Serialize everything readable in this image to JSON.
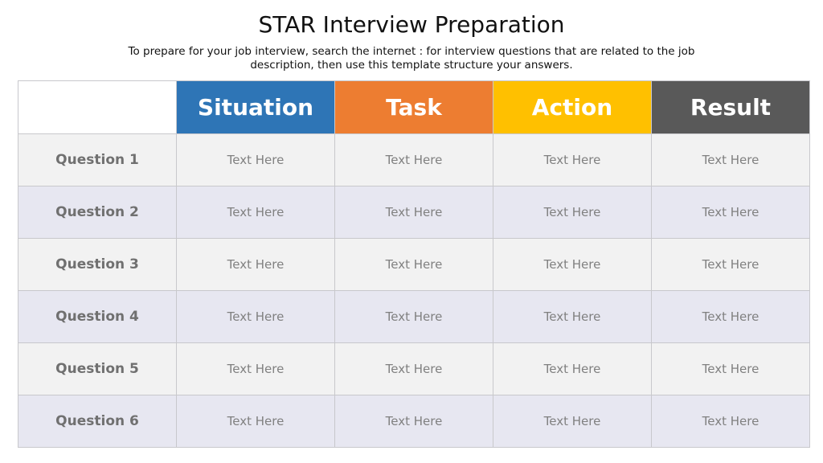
{
  "title": "STAR Interview Preparation",
  "subtitle": "To prepare for your job interview, search the internet : for interview questions that are related to the job description, then use this template structure your answers.",
  "columns": [
    {
      "label": "Situation",
      "color": "#2e75b6"
    },
    {
      "label": "Task",
      "color": "#ed7d31"
    },
    {
      "label": "Action",
      "color": "#ffc000"
    },
    {
      "label": "Result",
      "color": "#595959"
    }
  ],
  "rows": [
    {
      "label": "Question 1",
      "cells": [
        "Text Here",
        "Text Here",
        "Text Here",
        "Text Here"
      ]
    },
    {
      "label": "Question 2",
      "cells": [
        "Text Here",
        "Text Here",
        "Text Here",
        "Text Here"
      ]
    },
    {
      "label": "Question 3",
      "cells": [
        "Text Here",
        "Text Here",
        "Text Here",
        "Text Here"
      ]
    },
    {
      "label": "Question 4",
      "cells": [
        "Text Here",
        "Text Here",
        "Text Here",
        "Text Here"
      ]
    },
    {
      "label": "Question 5",
      "cells": [
        "Text Here",
        "Text Here",
        "Text Here",
        "Text Here"
      ]
    },
    {
      "label": "Question 6",
      "cells": [
        "Text Here",
        "Text Here",
        "Text Here",
        "Text Here"
      ]
    }
  ]
}
